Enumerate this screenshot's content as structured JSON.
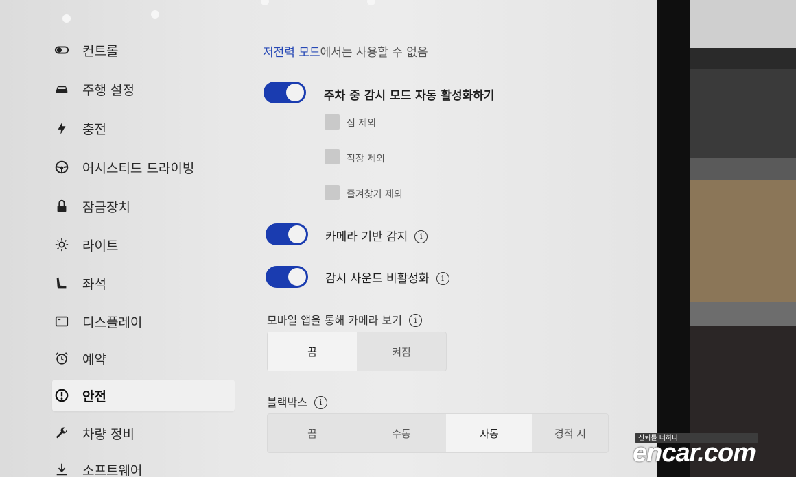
{
  "sidebar": {
    "items": [
      {
        "label": "컨트롤",
        "icon": "toggle-icon"
      },
      {
        "label": "주행 설정",
        "icon": "car-icon"
      },
      {
        "label": "충전",
        "icon": "lightning-icon"
      },
      {
        "label": "어시스티드 드라이빙",
        "icon": "steering-wheel-icon"
      },
      {
        "label": "잠금장치",
        "icon": "lock-icon"
      },
      {
        "label": "라이트",
        "icon": "sun-icon"
      },
      {
        "label": "좌석",
        "icon": "seat-icon"
      },
      {
        "label": "디스플레이",
        "icon": "display-icon"
      },
      {
        "label": "예약",
        "icon": "alarm-clock-icon"
      },
      {
        "label": "안전",
        "icon": "alert-circle-icon"
      },
      {
        "label": "차량 정비",
        "icon": "wrench-icon"
      },
      {
        "label": "소프트웨어",
        "icon": "download-icon"
      }
    ],
    "active_index": 9
  },
  "main": {
    "notice_link": "저전력 모드",
    "notice_rest": "에서는 사용할 수 없음",
    "sentry_auto": {
      "label": "주차 중 감시 모드 자동 활성화하기",
      "on": true
    },
    "exclusions": [
      {
        "label": "집 제외",
        "checked": false
      },
      {
        "label": "직장 제외",
        "checked": false
      },
      {
        "label": "즐겨찾기 제외",
        "checked": false
      }
    ],
    "camera_detection": {
      "label": "카메라 기반 감지",
      "on": true
    },
    "sentry_sound": {
      "label": "감시 사운드 비활성화",
      "on": true
    },
    "mobile_view": {
      "label": "모바일 앱을 통해 카메라 보기",
      "options": [
        "끔",
        "켜짐"
      ],
      "selected": 0
    },
    "dashcam": {
      "label": "블랙박스",
      "options": [
        "끔",
        "수동",
        "자동",
        "경적 시"
      ],
      "selected": 2
    }
  },
  "watermark": {
    "small": "신뢰를 더하다",
    "big": "encar.com"
  },
  "colors": {
    "accent": "#1a3cb0",
    "link": "#2749b5"
  }
}
